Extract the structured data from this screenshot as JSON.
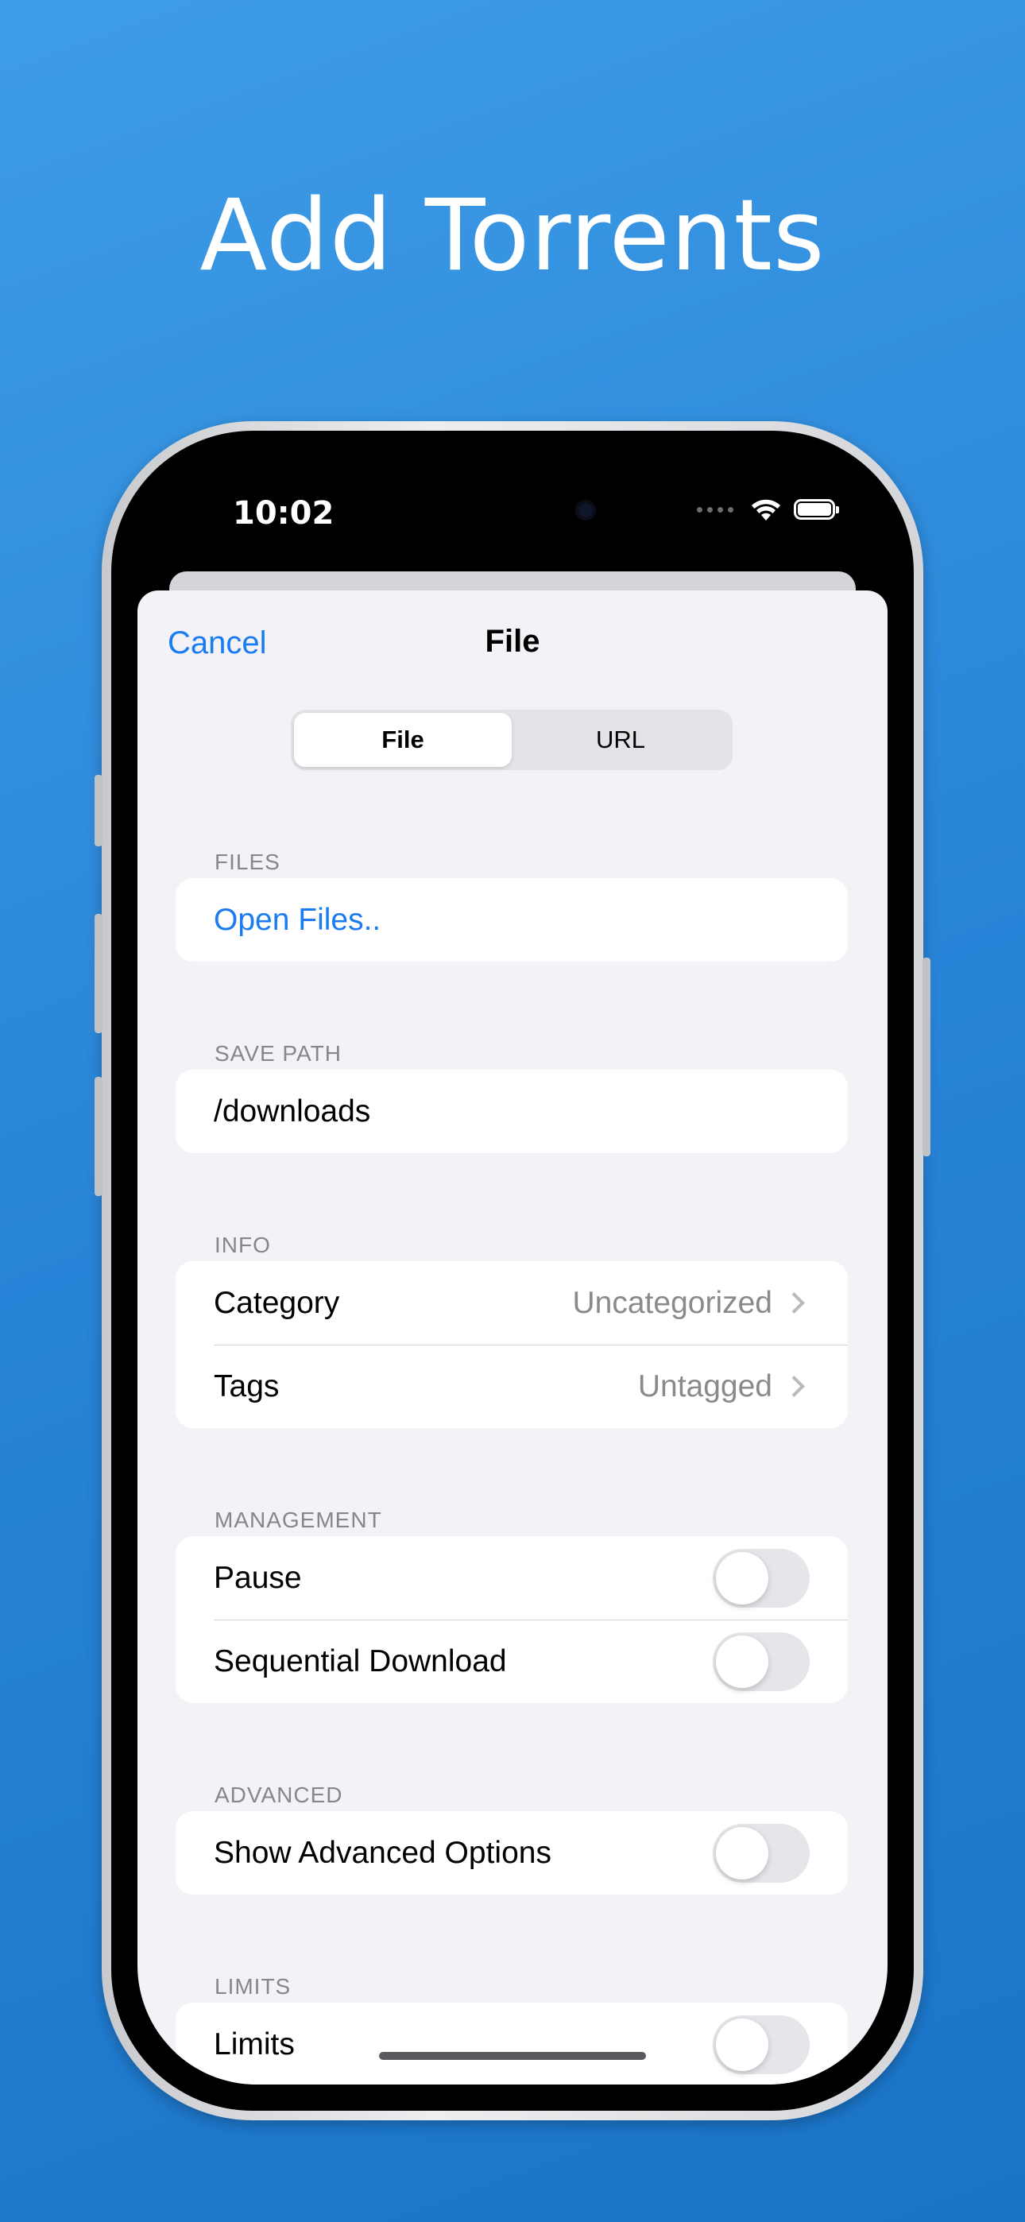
{
  "headline": "Add Torrents",
  "status_bar": {
    "time": "10:02"
  },
  "nav": {
    "cancel_label": "Cancel",
    "title": "File"
  },
  "segmented": {
    "options": [
      "File",
      "URL"
    ],
    "selected": "File"
  },
  "sections": {
    "files": {
      "header": "FILES",
      "open_files_label": "Open Files.."
    },
    "save_path": {
      "header": "SAVE PATH",
      "value": "/downloads"
    },
    "info": {
      "header": "INFO",
      "category_label": "Category",
      "category_value": "Uncategorized",
      "tags_label": "Tags",
      "tags_value": "Untagged"
    },
    "management": {
      "header": "MANAGEMENT",
      "pause_label": "Pause",
      "pause_on": false,
      "sequential_label": "Sequential Download",
      "sequential_on": false
    },
    "advanced": {
      "header": "ADVANCED",
      "show_advanced_label": "Show Advanced Options",
      "show_advanced_on": false
    },
    "limits": {
      "header": "LIMITS",
      "limits_label": "Limits",
      "limits_on": false
    }
  },
  "colors": {
    "accent": "#1a7cf0",
    "background_top": "#3f9ce6",
    "background_bottom": "#1a74c8",
    "grouped_bg": "#f2f2f7"
  }
}
